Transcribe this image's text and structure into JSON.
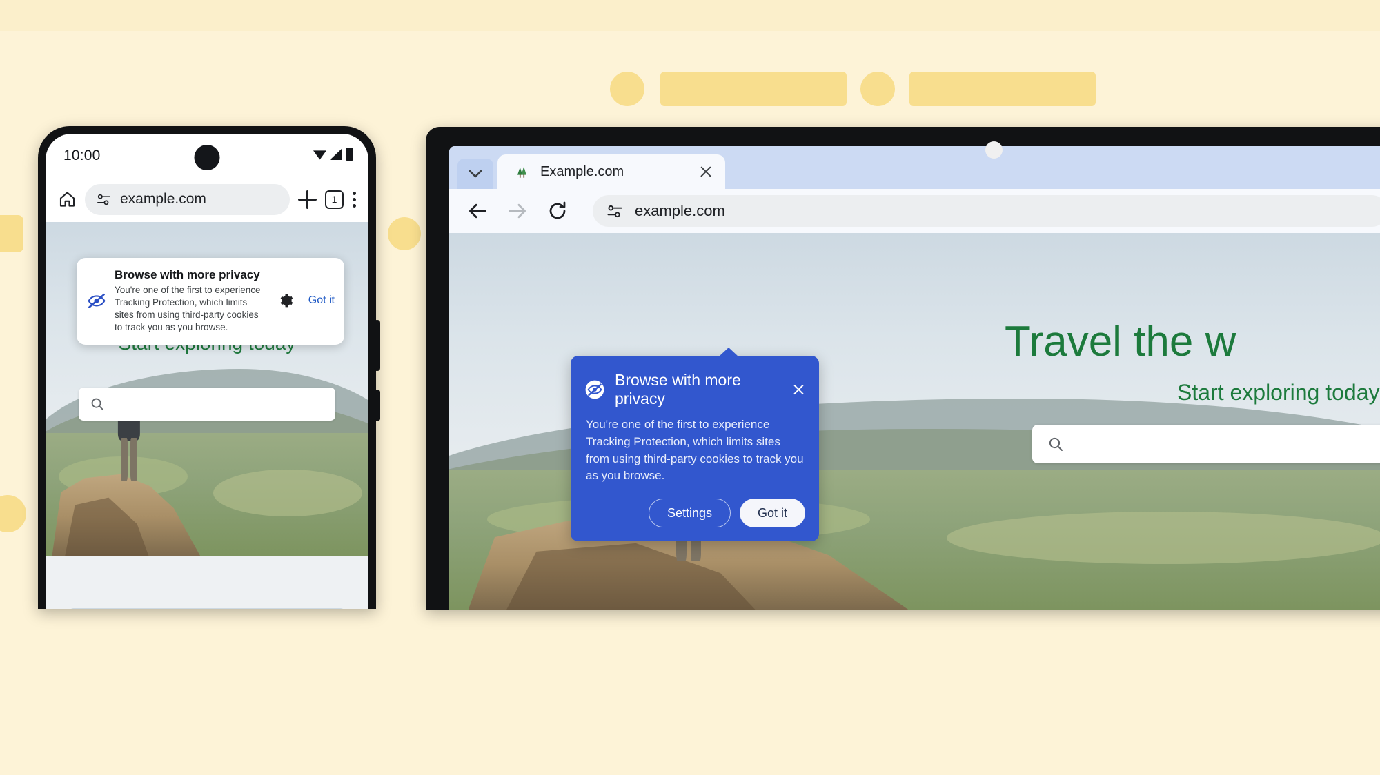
{
  "background": {
    "page_color": "#FDF3D7",
    "accent_color": "#F8DE8E"
  },
  "phone": {
    "status_bar": {
      "time": "10:00",
      "icons": [
        "wifi-icon",
        "signal-icon",
        "battery-icon"
      ]
    },
    "toolbar": {
      "home_icon": "home-icon",
      "site_settings_icon": "tune-icon",
      "url": "example.com",
      "new_tab_icon": "plus-icon",
      "tab_count": "1",
      "menu_icon": "kebab-menu-icon"
    },
    "page": {
      "heading": "Start exploring today",
      "search_placeholder": "",
      "search_icon": "search-icon"
    },
    "privacy_card": {
      "icon": "eye-slash-icon",
      "title": "Browse with more privacy",
      "description": "You're one of the first to experience Tracking Protection, which limits sites from using third-party cookies to track you as you browse.",
      "settings_icon": "gear-icon",
      "got_it_label": "Got it",
      "got_it_color": "#1a56c4"
    }
  },
  "tablet": {
    "tab_strip": {
      "chevron_icon": "chevron-down-icon",
      "tab": {
        "favicon": "tree-favicon",
        "title": "Example.com",
        "close_icon": "close-icon"
      }
    },
    "toolbar": {
      "back_icon": "back-arrow-icon",
      "forward_icon": "forward-arrow-icon",
      "reload_icon": "reload-icon",
      "site_settings_icon": "tune-icon",
      "url": "example.com"
    },
    "page": {
      "heading": "Travel the w",
      "subheading": "Start exploring today",
      "search_icon": "search-icon",
      "heading_color": "#1c7a3c"
    },
    "tooltip": {
      "background_color": "#3257CE",
      "icon": "eye-slash-icon",
      "title": "Browse with more privacy",
      "description": "You're one of the first to experience Tracking Protection, which limits sites from using third-party cookies to track you as you browse.",
      "close_icon": "close-icon",
      "settings_label": "Settings",
      "got_it_label": "Got it"
    }
  }
}
